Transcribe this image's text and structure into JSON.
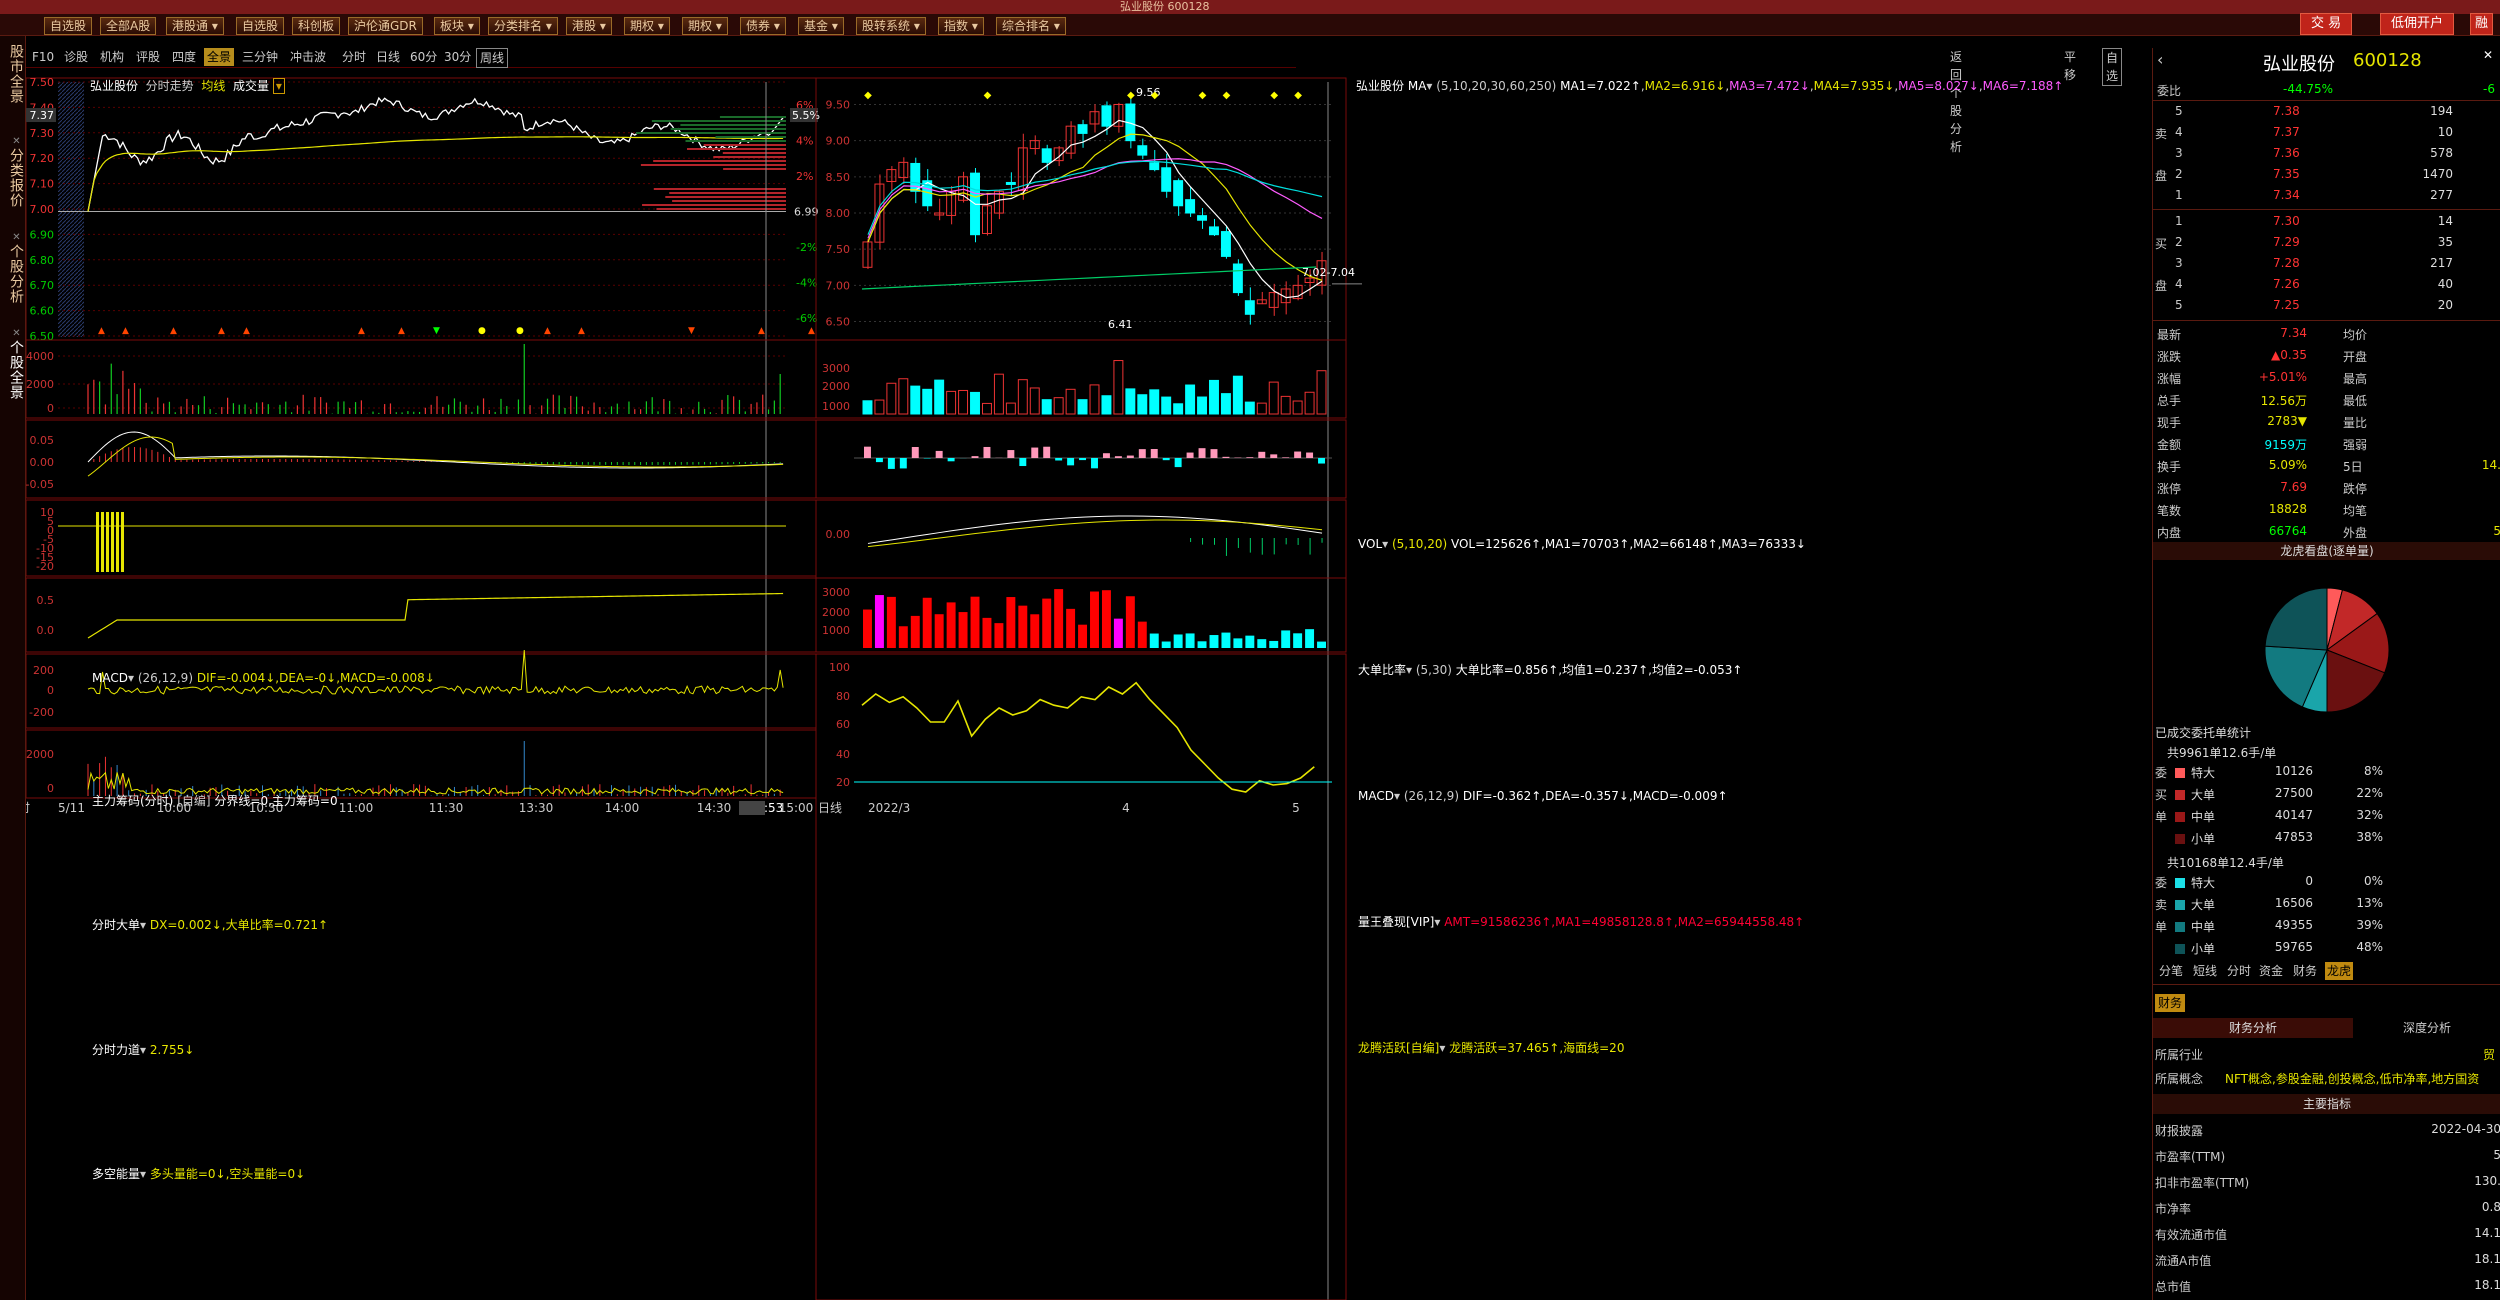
{
  "titlebar": {
    "text": "弘业股份 600128"
  },
  "menu": [
    {
      "label": "自选股",
      "caret": false
    },
    {
      "label": "全部A股",
      "caret": false
    },
    {
      "label": "港股通",
      "caret": true
    },
    {
      "label": "自选股",
      "caret": false
    },
    {
      "label": "科创板",
      "caret": false
    },
    {
      "label": "沪伦通GDR",
      "caret": false
    },
    {
      "label": "板块",
      "caret": true
    },
    {
      "label": "分类排名",
      "caret": true
    },
    {
      "label": "港股",
      "caret": true
    },
    {
      "label": "期权",
      "caret": true
    },
    {
      "label": "期权",
      "caret": true
    },
    {
      "label": "债券",
      "caret": true
    },
    {
      "label": "基金",
      "caret": true
    },
    {
      "label": "股转系统",
      "caret": true
    },
    {
      "label": "指数",
      "caret": true
    },
    {
      "label": "综合排名",
      "caret": true
    }
  ],
  "trade_buttons": {
    "trade": "交 易",
    "margin": "低佣开户",
    "more": "融"
  },
  "left_tabs": [
    {
      "label": "股市全景"
    },
    {
      "label": "分类报价"
    },
    {
      "label": "个股分析"
    },
    {
      "label": "个股全景"
    }
  ],
  "subbar": {
    "items": [
      "F10",
      "诊股",
      "机构",
      "评股",
      "四度",
      "全景",
      "三分钟",
      "冲击波"
    ],
    "selected": "全景",
    "tf": [
      "分时",
      "日线",
      "60分",
      "30分",
      "周线"
    ],
    "selected_tf": "周线",
    "right": [
      "返回个股分析",
      "平移",
      "自选"
    ]
  },
  "stock": {
    "name": "弘业股份",
    "code": "600128",
    "last": "7.37"
  },
  "intraday": {
    "title": "弘业股份",
    "subtitle": "分时走势",
    "avg": "均线",
    "vol": "成交量",
    "left_ticks": [
      "7.50",
      "7.40",
      "7.30",
      "7.20",
      "7.10",
      "7.00",
      "6.90",
      "6.80",
      "6.70",
      "6.60",
      "6.50"
    ],
    "right_ticks": [
      "6%",
      "4%",
      "2%",
      "-2%",
      "-4%",
      "-6%"
    ],
    "right_pct": "5.5%",
    "base": "6.99",
    "vol_ticks": [
      "4000",
      "2000",
      "0"
    ],
    "x_ticks": [
      "5/11",
      "10:00",
      "10:30",
      "11:00",
      "11:30",
      "13:30",
      "14:00",
      "14:30",
      "14:53",
      "15:00"
    ],
    "x_label": "分时"
  },
  "intraday_panels": [
    {
      "name": "MACD",
      "params": "(26,12,9)",
      "vals": "DIF=-0.004↓,DEA=-0↓,MACD=-0.008↓",
      "ticks": [
        "0.05",
        "0.00",
        "-0.05"
      ]
    },
    {
      "name": "主力筹码(分时)",
      "params": "[自编]",
      "vals": "分界线=0,主力筹码=0",
      "ticks": [
        "10",
        "5",
        "0",
        "-5",
        "-10",
        "-15",
        "-20"
      ]
    },
    {
      "name": "分时大单",
      "params": "",
      "vals": "DX=0.002↓,大单比率=0.721↑",
      "ticks": [
        "0.5",
        "0.0"
      ]
    },
    {
      "name": "分时力道",
      "params": "",
      "vals": "2.755↓",
      "ticks": [
        "200",
        "0",
        "-200"
      ]
    },
    {
      "name": "多空能量",
      "params": "",
      "vals": "多头量能=0↓,空头量能=0↓",
      "ticks": [
        "2000",
        "0"
      ]
    }
  ],
  "daily": {
    "title": "弘业股份",
    "ma": "MA",
    "params": "(5,10,20,30,60,250)",
    "ma_vals": [
      "MA1=7.022↑",
      "MA2=6.916↓",
      "MA3=7.472↓",
      "MA4=7.935↓",
      "MA5=8.027↓",
      "MA6=7.188↑"
    ],
    "ticks": [
      "9.50",
      "9.00",
      "8.50",
      "8.00",
      "7.50",
      "7.00",
      "6.50"
    ],
    "hi": "9.56",
    "lo": "6.41",
    "range": "7.02-7.04",
    "vol": {
      "name": "VOL",
      "params": "(5,10,20)",
      "vals": "VOL=125626↑,MA1=70703↑,MA2=66148↑,MA3=76333↓",
      "ticks": [
        "3000",
        "2000",
        "1000"
      ]
    },
    "ratio": {
      "name": "大单比率",
      "params": "(5,30)",
      "vals": "大单比率=0.856↑,均值1=0.237↑,均值2=-0.053↑"
    },
    "macd": {
      "name": "MACD",
      "params": "(26,12,9)",
      "vals": "DIF=-0.362↑,DEA=-0.357↓,MACD=-0.009↑",
      "tick": "0.00"
    },
    "amt": {
      "name": "量王叠现[VIP]",
      "vals": "AMT=91586236↑,MA1=49858128.8↑,MA2=65944558.48↑",
      "ticks": [
        "3000",
        "2000",
        "1000"
      ]
    },
    "dragon": {
      "name": "龙腾活跃[自编]",
      "vals": "龙腾活跃=37.465↑,海面线=20",
      "ticks": [
        "100",
        "80",
        "60",
        "40",
        "20"
      ]
    },
    "x_ticks": [
      "2022/3",
      "4",
      "5"
    ],
    "x_label": "日线"
  },
  "quote": {
    "name": "弘业股份",
    "code": "600128",
    "webi": {
      "label": "委比",
      "pct": "-44.75%",
      "val": "-6"
    },
    "asks": [
      {
        "lv": "5",
        "price": "7.38",
        "vol": "194"
      },
      {
        "lv": "4",
        "price": "7.37",
        "vol": "10"
      },
      {
        "lv": "3",
        "price": "7.36",
        "vol": "578"
      },
      {
        "lv": "2",
        "price": "7.35",
        "vol": "1470"
      },
      {
        "lv": "1",
        "price": "7.34",
        "vol": "277"
      }
    ],
    "bids": [
      {
        "lv": "1",
        "price": "7.30",
        "vol": "14"
      },
      {
        "lv": "2",
        "price": "7.29",
        "vol": "35"
      },
      {
        "lv": "3",
        "price": "7.28",
        "vol": "217"
      },
      {
        "lv": "4",
        "price": "7.26",
        "vol": "40"
      },
      {
        "lv": "5",
        "price": "7.25",
        "vol": "20"
      }
    ],
    "stats": [
      {
        "k": "最新",
        "v": "7.34",
        "k2": "均价",
        "v2": ""
      },
      {
        "k": "涨跌",
        "v": "▲0.35",
        "k2": "开盘",
        "v2": ""
      },
      {
        "k": "涨幅",
        "v": "+5.01%",
        "k2": "最高",
        "v2": ""
      },
      {
        "k": "总手",
        "v": "12.56万",
        "k2": "最低",
        "v2": ""
      },
      {
        "k": "现手",
        "v": "2783▼",
        "k2": "量比",
        "v2": ""
      },
      {
        "k": "金额",
        "v": "9159万",
        "k2": "强弱",
        "v2": ""
      },
      {
        "k": "换手",
        "v": "5.09%",
        "k2": "5日",
        "v2": "14."
      },
      {
        "k": "涨停",
        "v": "7.69",
        "k2": "跌停",
        "v2": ""
      },
      {
        "k": "笔数",
        "v": "18828",
        "k2": "均笔",
        "v2": ""
      },
      {
        "k": "内盘",
        "v": "66764",
        "k2": "外盘",
        "v2": "5"
      }
    ],
    "pie_title": "龙虎看盘(逐单量)",
    "pie": [
      {
        "v": 8,
        "c": "#ff5a5a"
      },
      {
        "v": 22,
        "c": "#c22828"
      },
      {
        "v": 32,
        "c": "#9a1818"
      },
      {
        "v": 38,
        "c": "#6a1010"
      },
      {
        "v": 13,
        "c": "#1aa5aa"
      },
      {
        "v": 39,
        "c": "#127a80"
      },
      {
        "v": 48,
        "c": "#0e5358"
      }
    ],
    "order_title": "已成交委托单统计",
    "buy_hdr": "共9961单12.6手/单",
    "buy_side": [
      "委",
      "买",
      "单"
    ],
    "buy": [
      {
        "k": "特大",
        "v": "10126",
        "p": "8%",
        "c": "#ff5a5a"
      },
      {
        "k": "大单",
        "v": "27500",
        "p": "22%",
        "c": "#c22828"
      },
      {
        "k": "中单",
        "v": "40147",
        "p": "32%",
        "c": "#9a1818"
      },
      {
        "k": "小单",
        "v": "47853",
        "p": "38%",
        "c": "#6a1010"
      }
    ],
    "sell_hdr": "共10168单12.4手/单",
    "sell_side": [
      "委",
      "卖",
      "单"
    ],
    "sell": [
      {
        "k": "特大",
        "v": "0",
        "p": "0%",
        "c": "#1ce0e8"
      },
      {
        "k": "大单",
        "v": "16506",
        "p": "13%",
        "c": "#1aa5aa"
      },
      {
        "k": "中单",
        "v": "49355",
        "p": "39%",
        "c": "#127a80"
      },
      {
        "k": "小单",
        "v": "59765",
        "p": "48%",
        "c": "#0e5358"
      }
    ],
    "tabs": [
      "分笔",
      "短线",
      "分时",
      "资金",
      "财务",
      "龙虎"
    ],
    "sel_tab": "龙虎",
    "fin_tab": "财务",
    "fin": [
      "财务分析",
      "深度分析"
    ],
    "rows": [
      {
        "k": "所属行业",
        "v": "贸"
      },
      {
        "k": "所属概念",
        "v": "NFT概念,参股金融,创投概念,低市净率,地方国资"
      }
    ],
    "indic_title": "主要指标",
    "indic": [
      {
        "k": "财报披露",
        "v": "2022-04-30"
      },
      {
        "k": "市盈率(TTM)",
        "v": "5"
      },
      {
        "k": "扣非市盈率(TTM)",
        "v": "130."
      },
      {
        "k": "市净率",
        "v": "0.8"
      },
      {
        "k": "有效流通市值",
        "v": "14.1"
      },
      {
        "k": "流通A市值",
        "v": "18.1"
      },
      {
        "k": "总市值",
        "v": "18.1"
      }
    ]
  }
}
